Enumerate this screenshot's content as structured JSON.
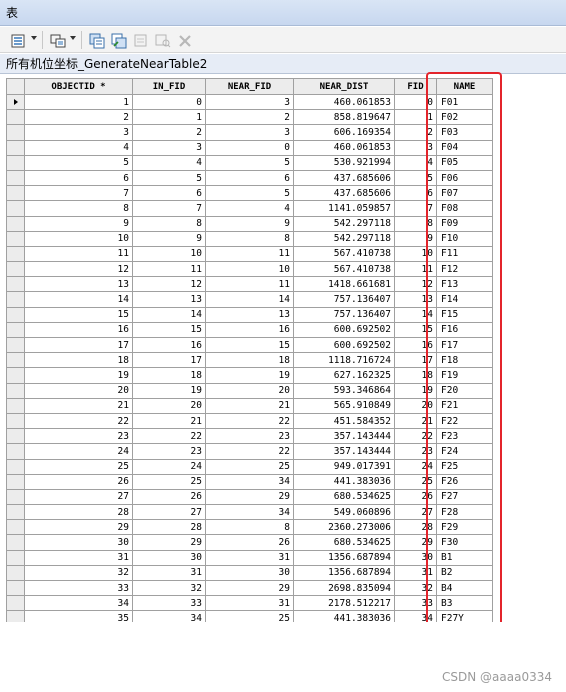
{
  "window": {
    "title": "表"
  },
  "toolbar": {
    "items": [
      "table-options",
      "related-tables",
      "select-by-attributes",
      "switch-selection",
      "clear-selection",
      "zoom-to-selected",
      "delete-selected"
    ]
  },
  "tab": {
    "label": "所有机位坐标_GenerateNearTable2"
  },
  "table": {
    "columns": [
      "OBJECTID *",
      "IN_FID",
      "NEAR_FID",
      "NEAR_DIST",
      "FID",
      "NAME"
    ],
    "rows": [
      [
        "1",
        "0",
        "3",
        "460.061853",
        "0",
        "F01"
      ],
      [
        "2",
        "1",
        "2",
        "858.819647",
        "1",
        "F02"
      ],
      [
        "3",
        "2",
        "3",
        "606.169354",
        "2",
        "F03"
      ],
      [
        "4",
        "3",
        "0",
        "460.061853",
        "3",
        "F04"
      ],
      [
        "5",
        "4",
        "5",
        "530.921994",
        "4",
        "F05"
      ],
      [
        "6",
        "5",
        "6",
        "437.685606",
        "5",
        "F06"
      ],
      [
        "7",
        "6",
        "5",
        "437.685606",
        "6",
        "F07"
      ],
      [
        "8",
        "7",
        "4",
        "1141.059857",
        "7",
        "F08"
      ],
      [
        "9",
        "8",
        "9",
        "542.297118",
        "8",
        "F09"
      ],
      [
        "10",
        "9",
        "8",
        "542.297118",
        "9",
        "F10"
      ],
      [
        "11",
        "10",
        "11",
        "567.410738",
        "10",
        "F11"
      ],
      [
        "12",
        "11",
        "10",
        "567.410738",
        "11",
        "F12"
      ],
      [
        "13",
        "12",
        "11",
        "1418.661681",
        "12",
        "F13"
      ],
      [
        "14",
        "13",
        "14",
        "757.136407",
        "13",
        "F14"
      ],
      [
        "15",
        "14",
        "13",
        "757.136407",
        "14",
        "F15"
      ],
      [
        "16",
        "15",
        "16",
        "600.692502",
        "15",
        "F16"
      ],
      [
        "17",
        "16",
        "15",
        "600.692502",
        "16",
        "F17"
      ],
      [
        "18",
        "17",
        "18",
        "1118.716724",
        "17",
        "F18"
      ],
      [
        "19",
        "18",
        "19",
        "627.162325",
        "18",
        "F19"
      ],
      [
        "20",
        "19",
        "20",
        "593.346864",
        "19",
        "F20"
      ],
      [
        "21",
        "20",
        "21",
        "565.910849",
        "20",
        "F21"
      ],
      [
        "22",
        "21",
        "22",
        "451.584352",
        "21",
        "F22"
      ],
      [
        "23",
        "22",
        "23",
        "357.143444",
        "22",
        "F23"
      ],
      [
        "24",
        "23",
        "22",
        "357.143444",
        "23",
        "F24"
      ],
      [
        "25",
        "24",
        "25",
        "949.017391",
        "24",
        "F25"
      ],
      [
        "26",
        "25",
        "34",
        "441.383036",
        "25",
        "F26"
      ],
      [
        "27",
        "26",
        "29",
        "680.534625",
        "26",
        "F27"
      ],
      [
        "28",
        "27",
        "34",
        "549.060896",
        "27",
        "F28"
      ],
      [
        "29",
        "28",
        "8",
        "2360.273006",
        "28",
        "F29"
      ],
      [
        "30",
        "29",
        "26",
        "680.534625",
        "29",
        "F30"
      ],
      [
        "31",
        "30",
        "31",
        "1356.687894",
        "30",
        "B1"
      ],
      [
        "32",
        "31",
        "30",
        "1356.687894",
        "31",
        "B2"
      ],
      [
        "33",
        "32",
        "29",
        "2698.835094",
        "32",
        "B4"
      ],
      [
        "34",
        "33",
        "31",
        "2178.512217",
        "33",
        "B3"
      ],
      [
        "35",
        "34",
        "25",
        "441.383036",
        "34",
        "F27Y"
      ]
    ]
  },
  "watermark": "CSDN @aaaa0334"
}
